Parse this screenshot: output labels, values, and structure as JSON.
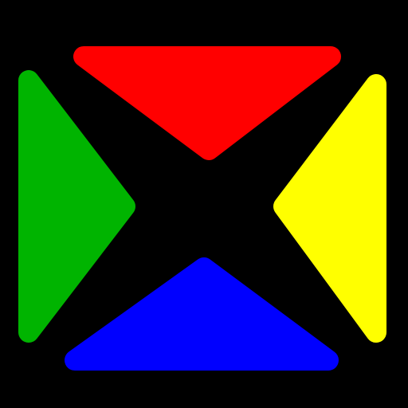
{
  "background_color": "#000000",
  "icon": {
    "name": "four-color-cross-logo-icon",
    "wedges": [
      {
        "id": "top",
        "name": "red-wedge",
        "color": "#ff0000"
      },
      {
        "id": "left",
        "name": "green-wedge",
        "color": "#00b400"
      },
      {
        "id": "right",
        "name": "yellow-wedge",
        "color": "#ffff00"
      },
      {
        "id": "bottom",
        "name": "blue-wedge",
        "color": "#0000ff"
      }
    ]
  }
}
